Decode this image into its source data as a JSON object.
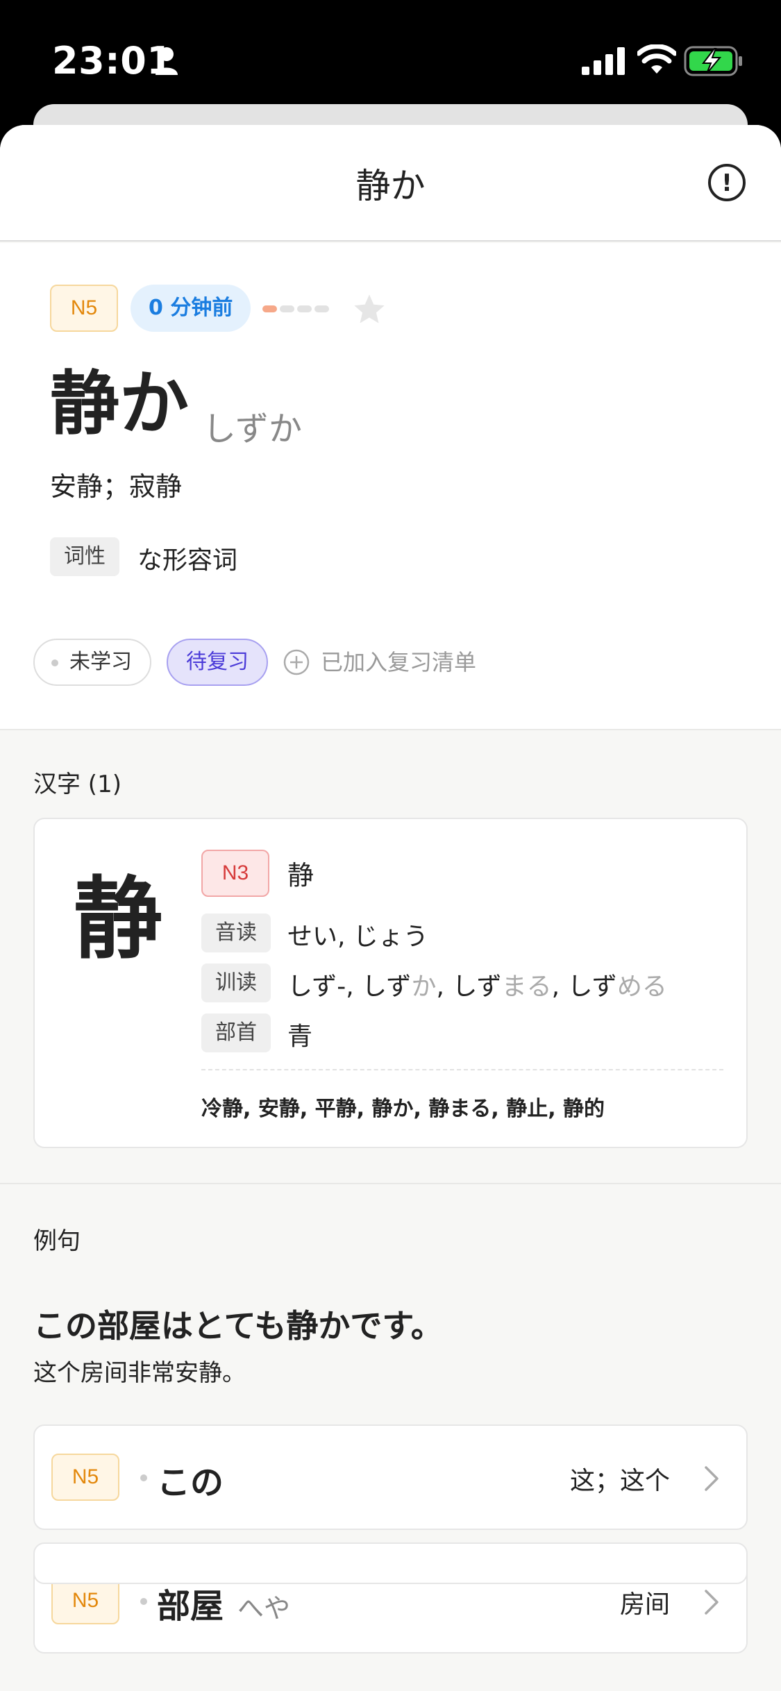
{
  "status_bar": {
    "time": "23:01"
  },
  "sheet": {
    "title": "静か"
  },
  "word": {
    "level": "N5",
    "time_ago": "0 分钟前",
    "progress_fraction": 0.25,
    "text": "静か",
    "reading": "しずか",
    "meaning": "安静；寂静",
    "pos_label": "词性",
    "pos_value": "な形容词",
    "chip_unlearned": "未学习",
    "chip_review": "待复习",
    "added_review": "已加入复习清单"
  },
  "kanji_section": {
    "heading": "汉字 (1)",
    "card": {
      "kanji": "静",
      "level": "N3",
      "char": "静",
      "onyomi_label": "音读",
      "onyomi": "せい, じょう",
      "kunyomi_label": "训读",
      "kunyomi_parts": [
        "しず-, しず",
        "か",
        ", しず",
        "まる",
        ", しず",
        "める"
      ],
      "radical_label": "部首",
      "radical": "青",
      "compounds": "冷静, 安静, 平静, 静か, 静まる, 静止, 静的"
    }
  },
  "examples": {
    "heading": "例句",
    "sentence_jp": "この部屋はとても静かです。",
    "sentence_cn": "这个房间非常安静。",
    "vocab": [
      {
        "level": "N5",
        "word": "この",
        "reading": "",
        "meaning": "这；这个"
      },
      {
        "level": "N5",
        "word": "部屋",
        "reading": "へや",
        "meaning": "房间"
      }
    ]
  },
  "colors": {
    "n5_accent": "#e3880c",
    "n3_accent": "#d63a3a",
    "review_accent": "#4a3ad8",
    "time_accent": "#1a7de0"
  },
  "icons": [
    "person-icon",
    "signal-icon",
    "wifi-icon",
    "battery-charging-icon",
    "info-icon",
    "star-icon",
    "plus-circle-icon",
    "chevron-right-icon"
  ]
}
